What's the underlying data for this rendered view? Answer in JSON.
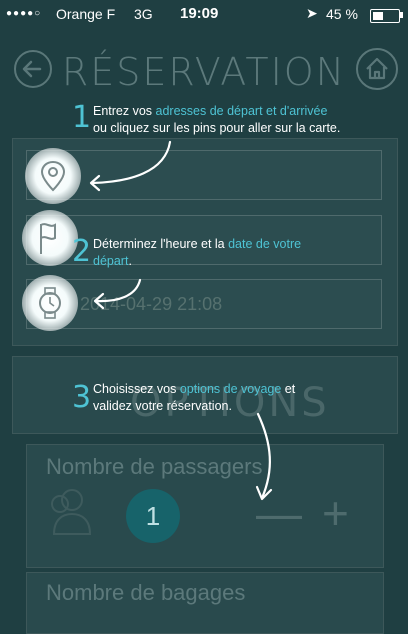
{
  "status": {
    "signal": "●●●●○",
    "carrier": "Orange F",
    "network": "3G",
    "time": "19:09",
    "location": "➤",
    "battery": "45 %"
  },
  "header": {
    "title": "RÉSERVATION"
  },
  "form": {
    "date_value": "2014-04-29 21:08"
  },
  "options": {
    "title": "OPTIONS",
    "passengers_label": "Nombre de passagers",
    "passengers_count": "1",
    "minus": "—",
    "plus": "+",
    "bags_label": "Nombre de bagages"
  },
  "tutorial": {
    "step1_num": "1",
    "step1_a": "Entrez vos ",
    "step1_hl": "adresses de départ et d'arrivée",
    "step1_b": "ou cliquez sur les pins pour aller sur la carte.",
    "step2_num": "2",
    "step2_a": "Déterminez l'heure et la ",
    "step2_hl1": "date de votre",
    "step2_hl2": "départ",
    "step2_b": ".",
    "step3_num": "3",
    "step3_a": "Choisissez vos ",
    "step3_hl": "options de voyage",
    "step3_b": " et",
    "step3_c": "validez votre réservation."
  },
  "colors": {
    "accent": "#4ec3d4",
    "background": "#1f3f42",
    "badge": "#17636a"
  }
}
